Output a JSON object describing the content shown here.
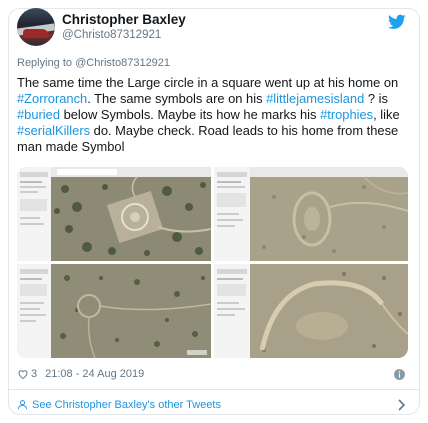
{
  "author": {
    "name": "Christopher Baxley",
    "handle": "@Christo87312921"
  },
  "reply_context": "Replying to @Christo87312921",
  "tweet": {
    "segments": [
      {
        "text": "The same time the Large circle in a square went up at his home on ",
        "tag": false
      },
      {
        "text": "#Zorroranch",
        "tag": true
      },
      {
        "text": ". The same symbols are on his ",
        "tag": false
      },
      {
        "text": "#littlejamesisland",
        "tag": true
      },
      {
        "text": " ? is ",
        "tag": false
      },
      {
        "text": "#buried",
        "tag": true
      },
      {
        "text": " below  Symbols. Maybe its how he marks his ",
        "tag": false
      },
      {
        "text": "#trophies",
        "tag": true
      },
      {
        "text": ", like ",
        "tag": false
      },
      {
        "text": "#serialKillers",
        "tag": true
      },
      {
        "text": " do. Maybe check. Road leads to his home from these man made Symbol",
        "tag": false
      }
    ]
  },
  "stats": {
    "likes": "3",
    "timestamp": "21:08 - 24 Aug 2019"
  },
  "footer": {
    "more_tweets_label": "See Christopher Baxley's other Tweets"
  },
  "icons": {
    "brand": "twitter-bird-icon",
    "like": "heart-icon",
    "info": "info-icon",
    "person": "person-icon",
    "chevron": "chevron-right-icon"
  },
  "colors": {
    "link": "#1b95e0",
    "text": "#14171a",
    "muted": "#657786",
    "border": "#e1e8ed"
  }
}
